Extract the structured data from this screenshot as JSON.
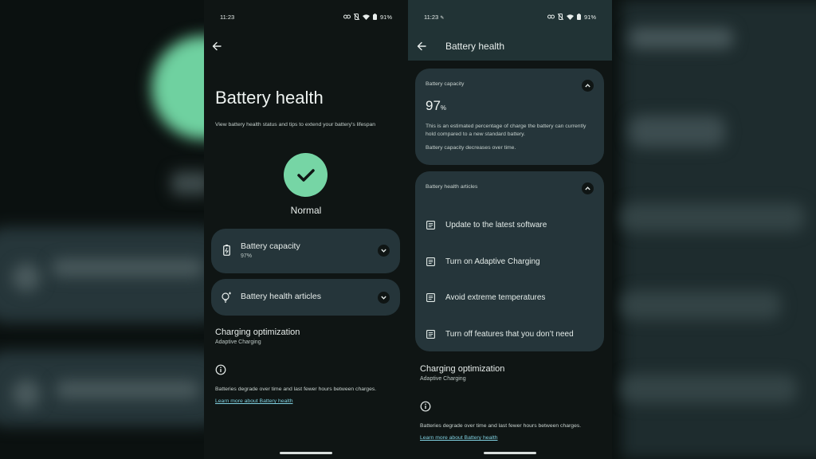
{
  "left_phone": {
    "status_bar": {
      "time": "11:23",
      "battery": "91%"
    },
    "title": "Battery health",
    "subtitle": "View battery health status and tips to extend your battery's lifespan",
    "health_status": "Normal",
    "capacity_card": {
      "title": "Battery capacity",
      "value": "97%"
    },
    "articles_card": {
      "title": "Battery health articles"
    },
    "charging": {
      "title": "Charging optimization",
      "subtitle": "Adaptive Charging"
    },
    "note": "Batteries degrade over time and last fewer hours between charges.",
    "link": "Learn more about Battery health"
  },
  "right_phone": {
    "status_bar": {
      "time": "11:23",
      "battery": "91%"
    },
    "header_title": "Battery health",
    "capacity_card": {
      "heading": "Battery capacity",
      "value": "97",
      "unit": "%",
      "description": "This is an estimated percentage of charge the battery can currently hold compared to a new standard battery.",
      "note": "Battery capacity decreases over time."
    },
    "articles_card": {
      "heading": "Battery health articles",
      "items": [
        {
          "label": "Update to the latest software"
        },
        {
          "label": "Turn on Adaptive Charging"
        },
        {
          "label": "Avoid extreme temperatures"
        },
        {
          "label": "Turn off features that you don’t need"
        }
      ]
    },
    "charging": {
      "title": "Charging optimization",
      "subtitle": "Adaptive Charging"
    },
    "note": "Batteries degrade over time and last fewer hours between charges.",
    "link": "Learn more about Battery health"
  },
  "colors": {
    "accent_green": "#76d5a5",
    "card_bg": "#25353a",
    "link": "#7fd0e0",
    "header_bg": "#213335"
  }
}
